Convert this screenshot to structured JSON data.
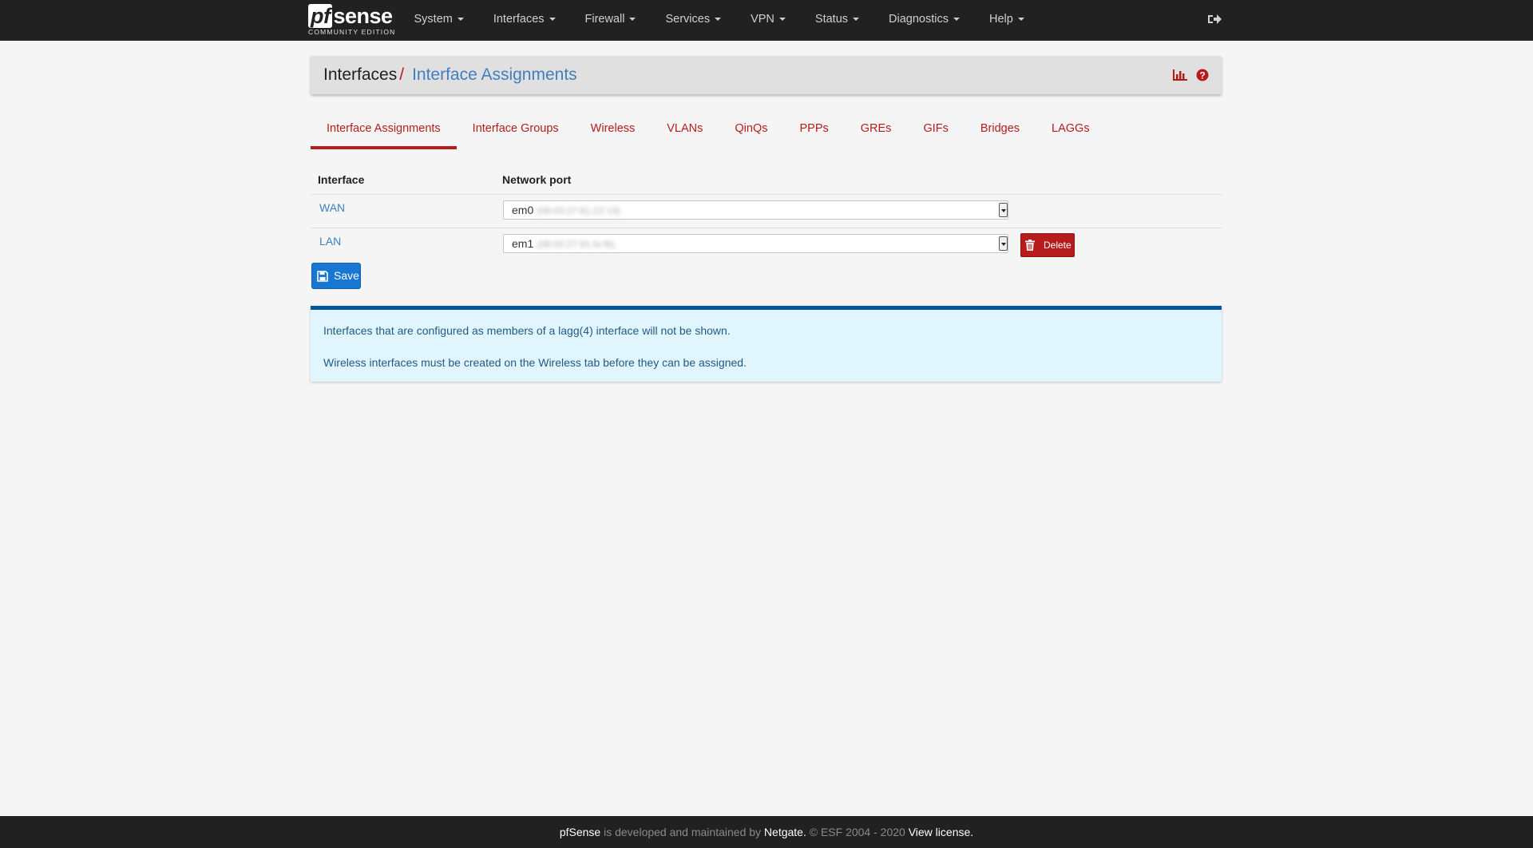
{
  "brand": {
    "logo_prefix": "pf",
    "logo_suffix": "sense",
    "edition": "COMMUNITY EDITION"
  },
  "nav": {
    "items": [
      {
        "label": "System"
      },
      {
        "label": "Interfaces"
      },
      {
        "label": "Firewall"
      },
      {
        "label": "Services"
      },
      {
        "label": "VPN"
      },
      {
        "label": "Status"
      },
      {
        "label": "Diagnostics"
      },
      {
        "label": "Help"
      }
    ],
    "logout_icon": "sign-out-icon"
  },
  "header": {
    "breadcrumb_root": "Interfaces",
    "separator": "/",
    "breadcrumb_current": "Interface Assignments",
    "icons": [
      "bar-chart-icon",
      "question-circle-icon"
    ],
    "icon_color": "#b71c1c"
  },
  "tabs": [
    {
      "label": "Interface Assignments",
      "active": true
    },
    {
      "label": "Interface Groups"
    },
    {
      "label": "Wireless"
    },
    {
      "label": "VLANs"
    },
    {
      "label": "QinQs"
    },
    {
      "label": "PPPs"
    },
    {
      "label": "GREs"
    },
    {
      "label": "GIFs"
    },
    {
      "label": "Bridges"
    },
    {
      "label": "LAGGs"
    }
  ],
  "table": {
    "headers": {
      "interface": "Interface",
      "port": "Network port"
    },
    "rows": [
      {
        "interface": "WAN",
        "port": "em0",
        "mac": "(08:00:27:81:22:19)"
      },
      {
        "interface": "LAN",
        "port": "em1",
        "mac": "(08:00:27:91:fe:f6)",
        "delete_label": "Delete"
      }
    ]
  },
  "save_label": "Save",
  "alert": {
    "lines": [
      "Interfaces that are configured as members of a lagg(4) interface will not be shown.",
      "Wireless interfaces must be created on the Wireless tab before they can be assigned."
    ]
  },
  "footer": {
    "product": "pfSense",
    "middle": " is developed and maintained by ",
    "company": "Netgate.",
    "copyright": " © ESF 2004 - 2020 ",
    "license_link": "View license."
  },
  "colors": {
    "navbar": "#212121",
    "accent_red": "#b71c1c",
    "link_blue": "#3f7fbf",
    "save_blue": "#1976d2",
    "alert_bg": "#e1f5fe",
    "alert_border": "#01579b"
  }
}
